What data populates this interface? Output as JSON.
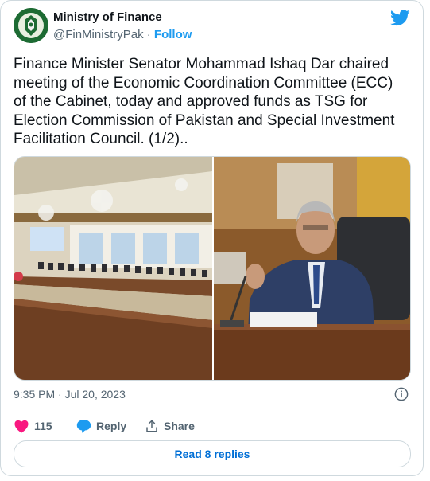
{
  "account": {
    "name": "Ministry of Finance",
    "handle": "@FinMinistryPak",
    "separator": "·",
    "follow_label": "Follow"
  },
  "tweet": {
    "text": "Finance Minister Senator Mohammad Ishaq Dar chaired meeting of the Economic Coordination Committee (ECC) of the Cabinet, today and approved funds as TSG for Election Commission of Pakistan and Special Investment Facilitation Council. (1/2)..",
    "timestamp": "9:35 PM · Jul 20, 2023"
  },
  "actions": {
    "like_count": "115",
    "reply_label": "Reply",
    "share_label": "Share"
  },
  "footer": {
    "read_replies_label": "Read 8 replies"
  },
  "icons": {
    "brand": "twitter-bird-icon",
    "like": "heart-icon",
    "reply": "speech-bubble-icon",
    "share": "share-arrow-icon",
    "info": "info-icon"
  },
  "colors": {
    "brand_blue": "#1d9bf0",
    "like_pink": "#f91880",
    "link_blue": "#006fd6",
    "muted_text": "#536471"
  }
}
